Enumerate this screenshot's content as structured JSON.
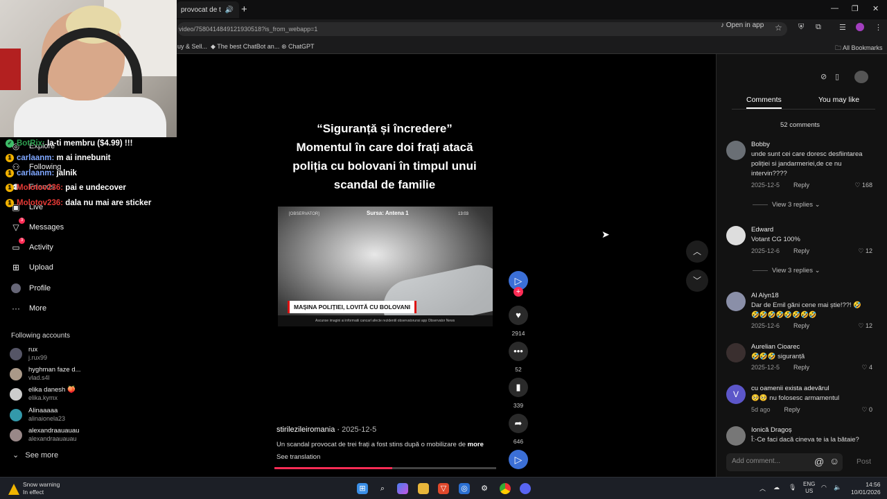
{
  "browser": {
    "tab_title": "provocat de t",
    "url": "video/7580414849121930518?is_from_webapp=1",
    "open_in_app": "Open in app",
    "bookmarks": [
      "uy & Sell...",
      "The best ChatBot an...",
      "ChatGPT"
    ],
    "all_bookmarks": "All Bookmarks"
  },
  "chat": [
    {
      "user": "BotRix:",
      "msg": "Ia-ti membru ($4.99) !!!",
      "icon": "1"
    },
    {
      "user": "carlaanm:",
      "msg": "m ai innebunit",
      "icon": "1"
    },
    {
      "user": "carlaanm:",
      "msg": "jalnik",
      "icon": "1"
    },
    {
      "user": "Molotov236:",
      "msg": "pai e undecover",
      "icon": "1"
    },
    {
      "user": "Molotov236:",
      "msg": "dala nu mai are sticker",
      "icon": "1"
    }
  ],
  "sidebar": {
    "nav": [
      {
        "label": "Explore",
        "icon": "compass-icon"
      },
      {
        "label": "Following",
        "icon": "following-icon"
      },
      {
        "label": "Friends",
        "icon": "friends-icon"
      },
      {
        "label": "Live",
        "icon": "live-icon"
      },
      {
        "label": "Messages",
        "icon": "messages-icon",
        "badge": "3"
      },
      {
        "label": "Activity",
        "icon": "activity-icon",
        "badge": "3"
      },
      {
        "label": "Upload",
        "icon": "upload-icon"
      },
      {
        "label": "Profile",
        "icon": "profile-icon"
      },
      {
        "label": "More",
        "icon": "more-icon"
      }
    ],
    "following_title": "Following accounts",
    "following": [
      {
        "name": "rux",
        "handle": "j.rux99"
      },
      {
        "name": "hyghman faze d...",
        "handle": "vlad.s4l"
      },
      {
        "name": "elika danesh 🍑",
        "handle": "elika.kymx"
      },
      {
        "name": "Alinaaaaa",
        "handle": "alinaionela23"
      },
      {
        "name": "alexandraauauau",
        "handle": "alexandraauauau"
      }
    ],
    "see_more": "See more"
  },
  "video": {
    "title_lines": [
      "“Siguranță și încredere”",
      "Momentul în care doi frați atacă",
      "poliția cu bolovani în timpul unui",
      "scandal de familie"
    ],
    "frame": {
      "channel": "[OBSERVATOR]",
      "source": "Sursa: Antena 1",
      "time": "13:03",
      "lower_third": "MAȘINA POLIȚIEI, LOVITĂ CU BOLOVANI",
      "footer": "Ascunse imagini ai informatii cancarl afecte rezidentil observatorunsi    app Observator News"
    },
    "author": "stirilezileiromania",
    "date": "2025-12-5",
    "description": "Un scandal provocat de trei frați a fost stins după o mobilizare de",
    "more": "more",
    "see_translation": "See translation",
    "progress": 0.53,
    "likes": "2914",
    "comments": "52",
    "saves": "339",
    "shares": "646"
  },
  "comments_panel": {
    "tabs": [
      "Comments",
      "You may like"
    ],
    "active_tab": "Comments",
    "count_label": "52 comments",
    "items": [
      {
        "name": "Bobby",
        "text": "unde sunt cei care doresc desfiintarea poliției si jandarmeriei,de ce nu intervin????",
        "date": "2025-12-5",
        "reply": "Reply",
        "likes": "168",
        "replies": "View 3 replies"
      },
      {
        "name": "Edward",
        "text": "Votant CG 100%",
        "date": "2025-12-6",
        "reply": "Reply",
        "likes": "12",
        "replies": "View 3 replies"
      },
      {
        "name": "Al Alyn18",
        "text": "Dar de Emil găni cene mai știe!??! 🤣 🤣🤣🤣🤣🤣🤣🤣🤣",
        "date": "2025-12-6",
        "reply": "Reply",
        "likes": "12"
      },
      {
        "name": "Aurelian Cioarec",
        "text": "🤣🤣🤣 siguranță",
        "date": "2025-12-5",
        "reply": "Reply",
        "likes": "4"
      },
      {
        "name": "cu oamenii exista adevărul",
        "text": "🥺🥺 nu folosesc armamentul",
        "date": "5d ago",
        "reply": "Reply",
        "likes": "0",
        "avatar_letter": "V"
      },
      {
        "name": "Ionică Dragoș",
        "text": "Î:-Ce faci dacă cineva te ia la bătaie?"
      }
    ],
    "add_comment_placeholder": "Add comment...",
    "post": "Post"
  },
  "taskbar": {
    "weather_title": "Snow warning",
    "weather_sub": "In effect",
    "lang": "ENG",
    "region": "US",
    "time": "14:56",
    "date": "10/01/2026"
  },
  "colors": {
    "accent": "#fe2c55",
    "panel": "#121212",
    "taskbar": "#1c1f26"
  }
}
